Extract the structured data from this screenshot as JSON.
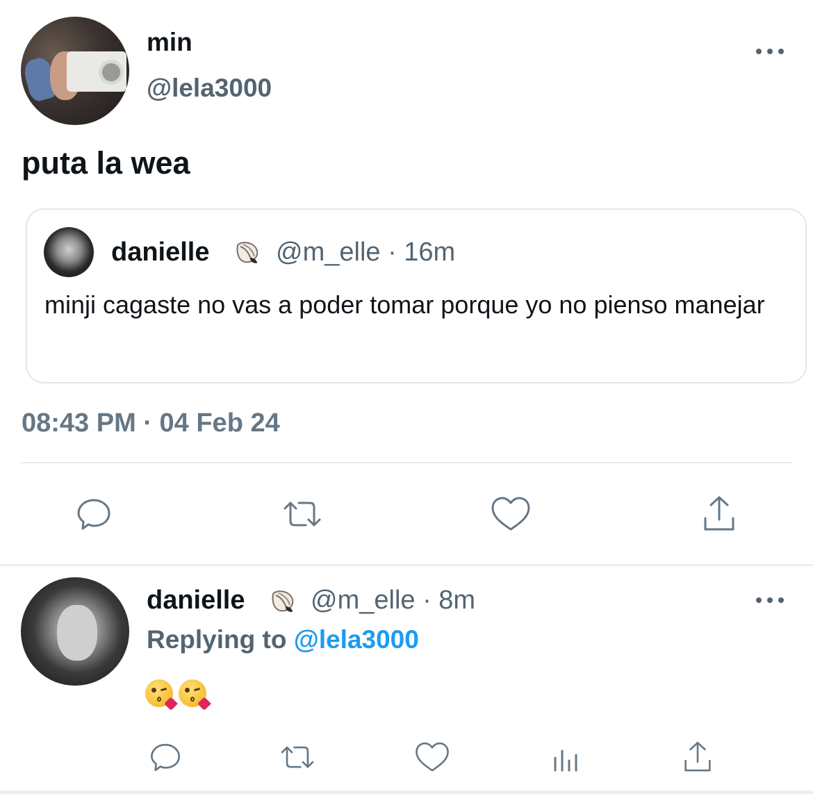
{
  "tweet": {
    "author_name": "min",
    "author_handle": "@lela3000",
    "text": "puta la wea",
    "timestamp": "08:43 PM · 04 Feb 24",
    "quote": {
      "author_name": "danielle",
      "handle_time": "@m_elle · 16m",
      "text": "minji cagaste no vas a poder tomar porque yo no pienso manejar",
      "name_emoji": "shell-emoji"
    },
    "actions": [
      "reply-icon",
      "retweet-icon",
      "like-icon",
      "share-icon"
    ]
  },
  "reply": {
    "author_name": "danielle",
    "handle_time": "@m_elle · 8m",
    "replying_prefix": "Replying to",
    "replying_mention": "@lela3000",
    "emojis": [
      "kissing-heart-emoji",
      "kissing-heart-emoji"
    ],
    "actions": [
      "reply-icon",
      "retweet-icon",
      "like-icon",
      "analytics-icon",
      "share-icon"
    ]
  },
  "colors": {
    "primary_text": "#0f1419",
    "secondary_text": "#536471",
    "link": "#1d9bf0",
    "icon": "#657786",
    "border": "#e2e8ee"
  }
}
